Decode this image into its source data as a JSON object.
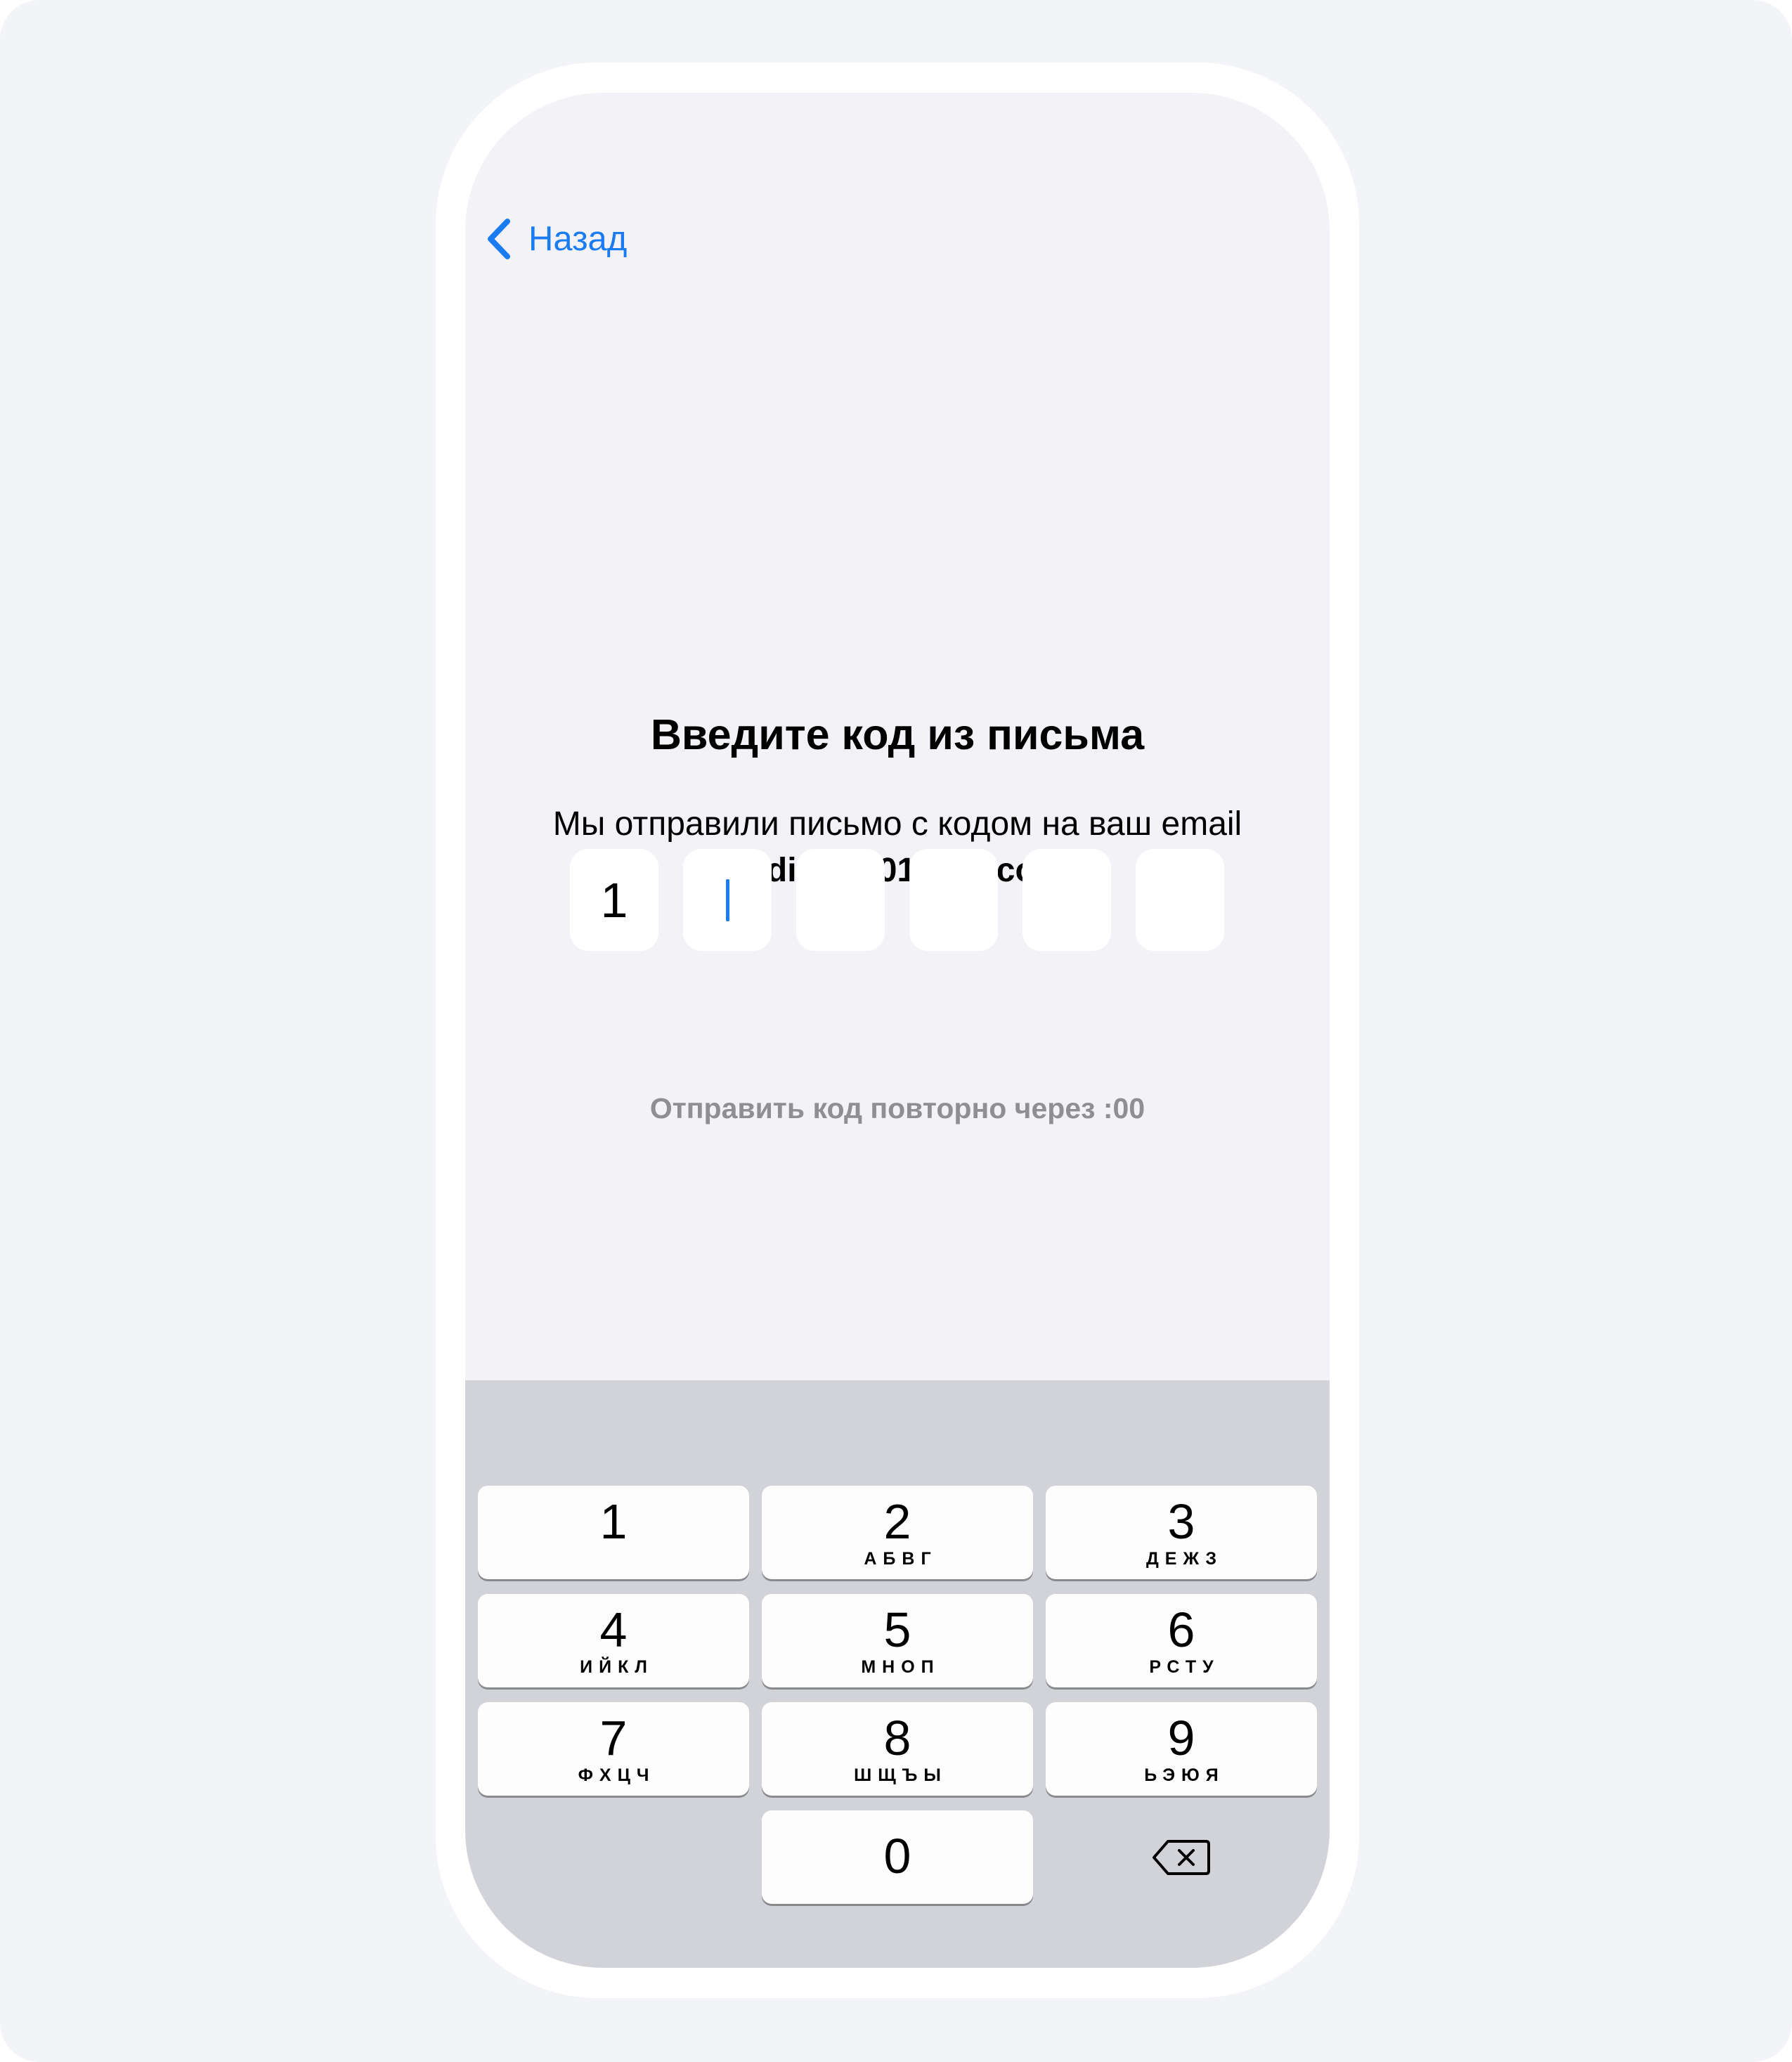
{
  "nav": {
    "back_label": "Назад"
  },
  "content": {
    "title": "Введите код из письма",
    "subtitle": "Мы отправили письмо с кодом на ваш email",
    "email": "vadim@101-app.com",
    "code_digits": [
      "1",
      "",
      "",
      "",
      "",
      ""
    ],
    "resend_text": "Отправить код повторно через :00"
  },
  "keyboard": {
    "keys": [
      {
        "digit": "1",
        "letters": ""
      },
      {
        "digit": "2",
        "letters": "АБВГ"
      },
      {
        "digit": "3",
        "letters": "ДЕЖЗ"
      },
      {
        "digit": "4",
        "letters": "ИЙКЛ"
      },
      {
        "digit": "5",
        "letters": "МНОП"
      },
      {
        "digit": "6",
        "letters": "РСТУ"
      },
      {
        "digit": "7",
        "letters": "ФХЦЧ"
      },
      {
        "digit": "8",
        "letters": "ШЩЪЫ"
      },
      {
        "digit": "9",
        "letters": "ЬЭЮЯ"
      },
      {
        "digit": "0",
        "letters": ""
      }
    ],
    "delete_icon": "backspace-icon"
  },
  "colors": {
    "accent": "#1a7cf0",
    "background": "#f3f4f8",
    "screen": "#f2f2f7",
    "keyboard": "#d1d3d9",
    "muted_text": "#8e8e93"
  }
}
